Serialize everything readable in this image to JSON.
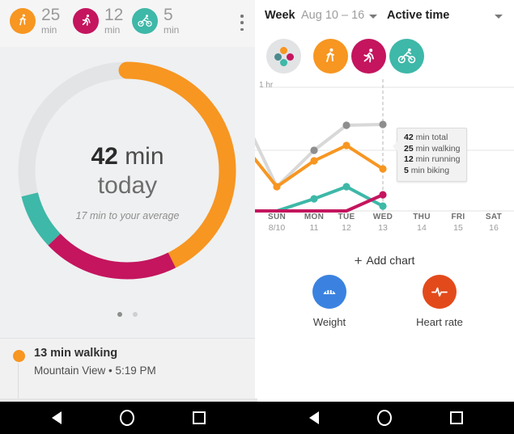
{
  "colors": {
    "walking": "#f79621",
    "running": "#c4155e",
    "biking": "#3eb8a8",
    "total": "#d5d5d5",
    "total_marker": "#8e8e8e",
    "weight": "#3b82e0",
    "heart_rate": "#e34a1b",
    "panel_bg": "#eff0f1"
  },
  "left_panel": {
    "chips": [
      {
        "icon": "walking-icon",
        "value": "25",
        "unit": "min",
        "color": "#f79621"
      },
      {
        "icon": "running-icon",
        "value": "12",
        "unit": "min",
        "color": "#c4155e"
      },
      {
        "icon": "biking-icon",
        "value": "5",
        "unit": "min",
        "color": "#3eb8a8"
      }
    ],
    "overflow_menu": "more-options",
    "donut": {
      "value": "42",
      "value_unit": "min",
      "subtitle": "today",
      "note": "17 min to your average",
      "segments": [
        {
          "name": "walking",
          "minutes": 25,
          "color": "#f79621"
        },
        {
          "name": "running",
          "minutes": 12,
          "color": "#c4155e"
        },
        {
          "name": "biking",
          "minutes": 5,
          "color": "#3eb8a8"
        },
        {
          "name": "remaining",
          "minutes": 17,
          "color": "#e3e4e5"
        }
      ]
    },
    "page_dots": {
      "count": 2,
      "active_index": 0
    },
    "activity_card": {
      "title": "13 min walking",
      "subtitle": "Mountain View • 5:19 PM",
      "dot_color": "#f79621"
    }
  },
  "right_panel": {
    "header": {
      "period_label": "Week",
      "date_range": "Aug 10 – 16",
      "period_caret": "chevron-down-icon",
      "metric": "Active time",
      "metric_caret": "chevron-down-icon"
    },
    "filters": [
      {
        "name": "all",
        "icon": "multi-dot-icon",
        "bg": "#e2e3e4",
        "selected": true
      },
      {
        "name": "walking",
        "icon": "walking-icon",
        "bg": "#f79621",
        "selected": false
      },
      {
        "name": "running",
        "icon": "running-icon",
        "bg": "#c4155e",
        "selected": false
      },
      {
        "name": "biking",
        "icon": "biking-icon",
        "bg": "#3eb8a8",
        "selected": false
      }
    ],
    "tooltip": [
      {
        "value": "42",
        "label": "min total"
      },
      {
        "value": "25",
        "label": "min walking"
      },
      {
        "value": "12",
        "label": "min running"
      },
      {
        "value": "5",
        "label": "min biking"
      }
    ],
    "add_chart": {
      "plus": "+",
      "label": "Add chart"
    },
    "shortcuts": [
      {
        "name": "weight",
        "label": "Weight",
        "icon": "scale-icon",
        "color": "#3b82e0"
      },
      {
        "name": "heart-rate",
        "label": "Heart rate",
        "icon": "pulse-icon",
        "color": "#e34a1b"
      }
    ]
  },
  "chart_data": {
    "type": "line",
    "title": "Active time",
    "xlabel": "",
    "ylabel": "",
    "ylim": [
      0,
      60
    ],
    "yunit": "min",
    "grid": true,
    "gridlines": [
      60,
      30
    ],
    "axis_labels": [
      {
        "value": 60,
        "text": "1 hr"
      }
    ],
    "legend": "none",
    "highlight_day": "WED",
    "categories": [
      "SUN",
      "MON",
      "TUE",
      "WED",
      "THU",
      "FRI",
      "SAT"
    ],
    "tick_sublabels": [
      "8/10",
      "11",
      "12",
      "13",
      "14",
      "15",
      "16"
    ],
    "series": [
      {
        "name": "total",
        "color": "#d5d5d5",
        "marker_color": "#8e8e8e",
        "values": [
          9,
          31,
          45,
          45,
          null,
          null,
          null
        ]
      },
      {
        "name": "walking",
        "color": "#f79621",
        "marker_color": "#f79621",
        "values": [
          9,
          24,
          33,
          25,
          null,
          null,
          null
        ]
      },
      {
        "name": "running",
        "color": "#c4155e",
        "marker_color": "#c4155e",
        "values": [
          0,
          0,
          0,
          12,
          null,
          null,
          null
        ]
      },
      {
        "name": "biking",
        "color": "#3eb8a8",
        "marker_color": "#3eb8a8",
        "values": [
          0,
          6,
          12,
          5,
          null,
          null,
          null
        ]
      }
    ],
    "annotations": [
      {
        "at": "WED",
        "lines": [
          "42 min total",
          "25 min walking",
          "12 min running",
          "5 min biking"
        ]
      }
    ]
  },
  "navbar": {
    "items": [
      {
        "name": "back-button",
        "icon": "back-triangle-icon"
      },
      {
        "name": "home-button",
        "icon": "home-circle-icon"
      },
      {
        "name": "recents-button",
        "icon": "recents-square-icon"
      }
    ]
  }
}
